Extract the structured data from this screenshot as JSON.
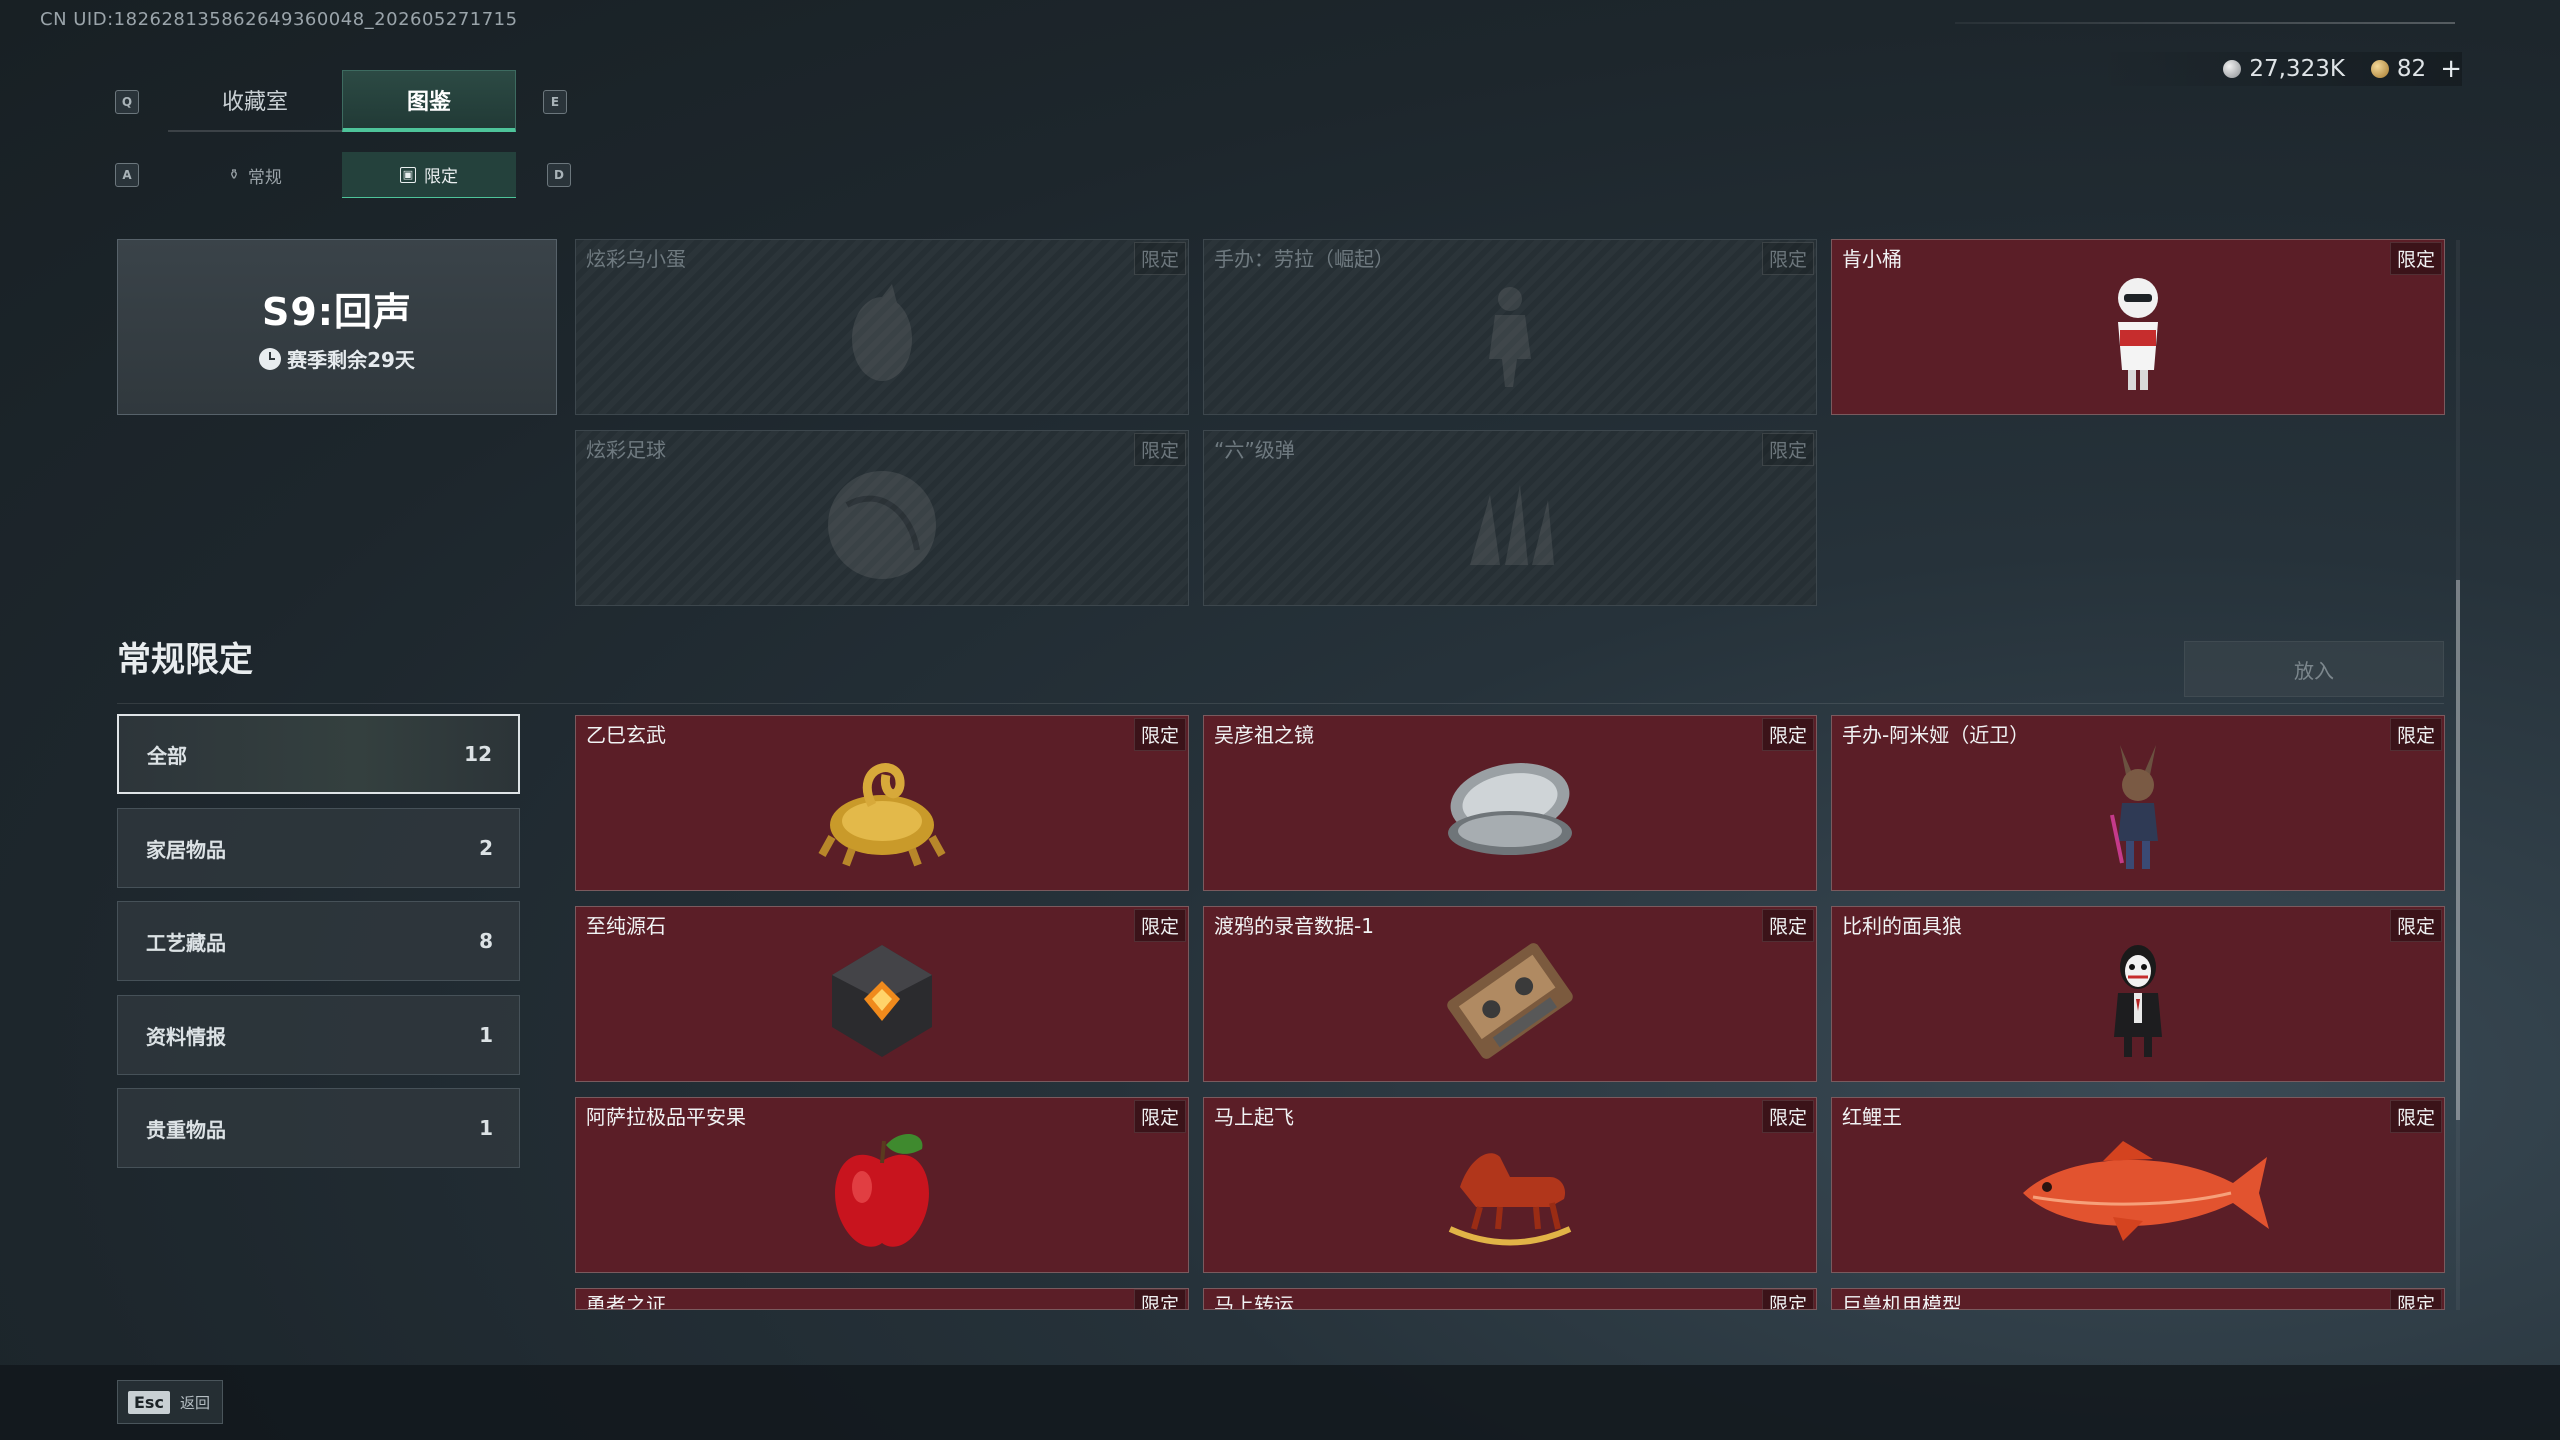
{
  "uid_text": "CN UID:1826281358626493600​48_202605271715",
  "currency": {
    "silver": "27,323K",
    "gold": "82",
    "add": "+"
  },
  "keys": {
    "prev_tab": "Q",
    "next_tab": "E",
    "prev_sub": "A",
    "next_sub": "D"
  },
  "tabs": [
    {
      "label": "收藏室"
    },
    {
      "label": "图鉴"
    }
  ],
  "subtabs": [
    {
      "label": "常规"
    },
    {
      "label": "限定"
    }
  ],
  "season": {
    "title": "S9:回声",
    "remaining": "赛季剩余29天"
  },
  "season_items": [
    {
      "name": "炫彩乌小蛋",
      "tag": "限定",
      "locked": true,
      "icon": "egg-icon"
    },
    {
      "name": "手办：劳拉（崛起）",
      "tag": "限定",
      "locked": true,
      "icon": "figure-icon"
    },
    {
      "name": "肯小桶",
      "tag": "限定",
      "locked": false,
      "icon": "bucket-figure-icon"
    },
    {
      "name": "炫彩足球",
      "tag": "限定",
      "locked": true,
      "icon": "football-icon"
    },
    {
      "name": "“六”级弹",
      "tag": "限定",
      "locked": true,
      "icon": "bullet-icon"
    }
  ],
  "section": {
    "title": "常规限定",
    "put_button": "放入"
  },
  "categories": [
    {
      "label": "全部",
      "count": "12"
    },
    {
      "label": "家居物品",
      "count": "2"
    },
    {
      "label": "工艺藏品",
      "count": "8"
    },
    {
      "label": "资料情报",
      "count": "1"
    },
    {
      "label": "贵重物品",
      "count": "1"
    }
  ],
  "items": [
    {
      "name": "乙巳玄武",
      "tag": "限定",
      "icon": "golden-snake-tortoise-icon"
    },
    {
      "name": "吴彦祖之镜",
      "tag": "限定",
      "icon": "compact-mirror-icon"
    },
    {
      "name": "手办-阿米娅（近卫）",
      "tag": "限定",
      "icon": "figure-amiya-icon"
    },
    {
      "name": "至纯源石",
      "tag": "限定",
      "icon": "originium-crystal-icon"
    },
    {
      "name": "渡鸦的录音数据-1",
      "tag": "限定",
      "icon": "cassette-tape-icon"
    },
    {
      "name": "比利的面具狼",
      "tag": "限定",
      "icon": "billy-puppet-icon"
    },
    {
      "name": "阿萨拉极品平安果",
      "tag": "限定",
      "icon": "apple-icon"
    },
    {
      "name": "马上起飞",
      "tag": "限定",
      "icon": "rocking-horse-icon"
    },
    {
      "name": "红鲤王",
      "tag": "限定",
      "icon": "red-carp-icon"
    },
    {
      "name": "勇者之证",
      "tag": "限定",
      "icon": "badge-icon"
    },
    {
      "name": "马上转运",
      "tag": "限定",
      "icon": "horse-icon"
    },
    {
      "name": "巨兽机甲模型",
      "tag": "限定",
      "icon": "mecha-icon"
    }
  ],
  "footer": {
    "esc_key": "Esc",
    "back_label": "返回"
  },
  "colors": {
    "accent": "#4ec49a",
    "card_bg": "#5b1e27",
    "locked_bg": "#262f34"
  }
}
